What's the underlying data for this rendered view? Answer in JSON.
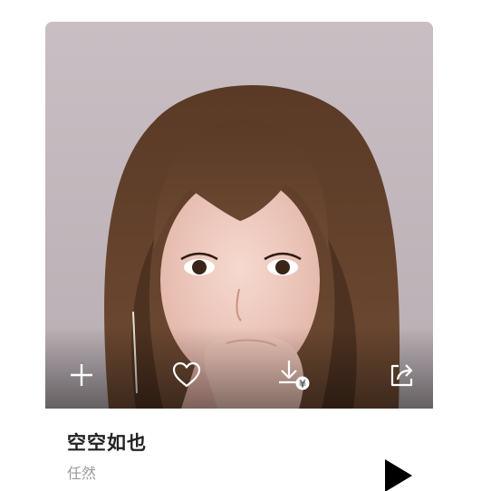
{
  "song": {
    "title": "空空如也",
    "artist": "任然"
  },
  "actions": [
    {
      "name": "add",
      "icon": "plus-icon"
    },
    {
      "name": "favorite",
      "icon": "heart-icon"
    },
    {
      "name": "download-paid",
      "icon": "download-yen-icon"
    },
    {
      "name": "share",
      "icon": "share-icon"
    }
  ],
  "controls": {
    "play_icon": "play-icon"
  },
  "colors": {
    "title": "#222222",
    "artist": "#9a9a9a",
    "icon": "#ffffff"
  }
}
